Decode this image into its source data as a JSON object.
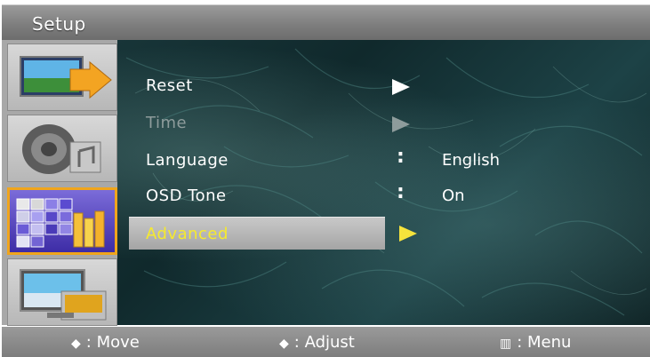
{
  "window": {
    "title": "Setup"
  },
  "sidebar": {
    "items": [
      {
        "icon": "picture-settings-icon",
        "selected": false
      },
      {
        "icon": "sound-speaker-icon",
        "selected": false
      },
      {
        "icon": "setup-grid-icon",
        "selected": true
      },
      {
        "icon": "input-source-icon",
        "selected": false
      }
    ]
  },
  "menu": {
    "items": [
      {
        "label": "Reset",
        "state": "enabled",
        "arrow": "white"
      },
      {
        "label": "Time",
        "state": "disabled",
        "arrow": "grey"
      },
      {
        "label": "Language",
        "state": "enabled",
        "value": "English"
      },
      {
        "label": "OSD Tone",
        "state": "enabled",
        "value": "On"
      },
      {
        "label": "Advanced",
        "state": "highlighted",
        "arrow": "yellow"
      }
    ],
    "separator": ":"
  },
  "statusbar": {
    "move": {
      "symbol": "◆",
      "label": ": Move"
    },
    "adjust": {
      "symbol": "◆",
      "label": ": Adjust"
    },
    "menu": {
      "symbol": "▥",
      "label": ": Menu"
    }
  },
  "colors": {
    "highlight_text": "#f6ea2d",
    "selected_icon_border": "#f0a51c",
    "background": "#163335"
  }
}
